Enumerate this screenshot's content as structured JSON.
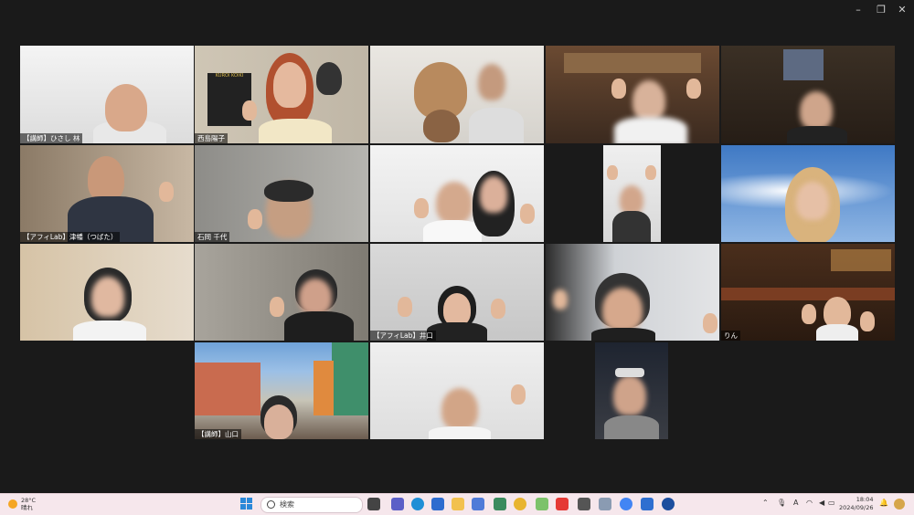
{
  "window": {
    "minimize": "–",
    "restore": "❐",
    "close": "✕"
  },
  "participants": [
    {
      "id": "p1",
      "name": "【講師】ひさし 林"
    },
    {
      "id": "p2",
      "name": "西島陽子"
    },
    {
      "id": "p3",
      "name": ""
    },
    {
      "id": "p4",
      "name": ""
    },
    {
      "id": "p5",
      "name": ""
    },
    {
      "id": "p6",
      "name": "【アフィLab】津幡（つばた）"
    },
    {
      "id": "p7",
      "name": "石岡 千代"
    },
    {
      "id": "p8",
      "name": ""
    },
    {
      "id": "p9",
      "name": ""
    },
    {
      "id": "p10",
      "name": ""
    },
    {
      "id": "p11",
      "name": ""
    },
    {
      "id": "p12",
      "name": ""
    },
    {
      "id": "p13",
      "name": "【アフィLab】井口"
    },
    {
      "id": "p14",
      "name": ""
    },
    {
      "id": "p15",
      "name": "りん"
    },
    {
      "id": "p16",
      "name": "【講師】山口"
    },
    {
      "id": "p17",
      "name": ""
    },
    {
      "id": "p18",
      "name": ""
    }
  ],
  "poster_text": "KUROI KOIKI",
  "taskbar": {
    "weather_temp": "28°C",
    "weather_desc": "晴れ",
    "search_placeholder": "検索",
    "time": "18:04",
    "date": "2024/09/26",
    "ime": "A",
    "notification_badge": "1"
  },
  "colors": {
    "active_speaker": "#3ddc84",
    "taskbar_bg": "#f6e7ec"
  }
}
